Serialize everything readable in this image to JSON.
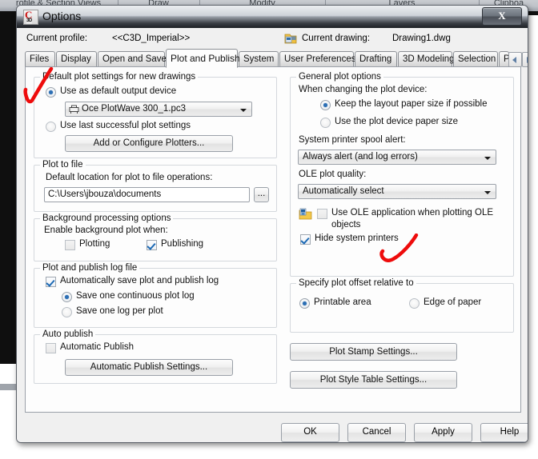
{
  "background": {
    "ribbon_tabs": [
      "rofile & Section Views",
      "Draw",
      "Modify",
      "Layers",
      "Clipboa"
    ]
  },
  "window": {
    "title": "Options",
    "icon": "civil3d-icon",
    "close_label": "X"
  },
  "profile_bar": {
    "current_profile_label": "Current profile:",
    "current_profile_value": "<<C3D_Imperial>>",
    "current_drawing_label": "Current drawing:",
    "current_drawing_value": "Drawing1.dwg",
    "drawing_icon": "drawing-file-icon"
  },
  "tabs": {
    "items": [
      {
        "label": "Files",
        "active": false
      },
      {
        "label": "Display",
        "active": false
      },
      {
        "label": "Open and Save",
        "active": false
      },
      {
        "label": "Plot and Publish",
        "active": true
      },
      {
        "label": "System",
        "active": false
      },
      {
        "label": "User Preferences",
        "active": false
      },
      {
        "label": "Drafting",
        "active": false
      },
      {
        "label": "3D Modeling",
        "active": false
      },
      {
        "label": "Selection",
        "active": false
      },
      {
        "label": "P",
        "active": false
      }
    ],
    "scroll_left": "◄",
    "scroll_right": "►"
  },
  "left_column": {
    "default_plot": {
      "title": "Default plot settings for new drawings",
      "radio_default_device": {
        "label": "Use as default output device",
        "checked": true
      },
      "device_combo": {
        "value": "Oce PlotWave 300_1.pc3",
        "icon": "plotter-icon"
      },
      "radio_last_settings": {
        "label": "Use last successful plot settings",
        "checked": false
      },
      "configure_button": "Add or Configure Plotters..."
    },
    "plot_to_file": {
      "title": "Plot to file",
      "label": "Default location for plot to file operations:",
      "path_value": "C:\\Users\\jbouza\\documents",
      "browse_button": "..."
    },
    "background_processing": {
      "title": "Background processing options",
      "label": "Enable background plot when:",
      "plotting": {
        "label": "Plotting",
        "checked": false
      },
      "publishing": {
        "label": "Publishing",
        "checked": true
      }
    },
    "log_file": {
      "title": "Plot and publish log file",
      "auto_save": {
        "label": "Automatically save plot and publish log",
        "checked": true
      },
      "continuous": {
        "label": "Save one continuous plot log",
        "checked": true
      },
      "per_plot": {
        "label": "Save one log per plot",
        "checked": false
      }
    },
    "auto_publish": {
      "title": "Auto publish",
      "automatic_publish": {
        "label": "Automatic Publish",
        "checked": false
      },
      "settings_button": "Automatic Publish Settings..."
    }
  },
  "right_column": {
    "general_plot": {
      "title": "General plot options",
      "when_changing_label": "When changing the plot device:",
      "keep_layout": {
        "label": "Keep the layout paper size if possible",
        "checked": true
      },
      "use_device_size": {
        "label": "Use the plot device paper size",
        "checked": false
      },
      "spool_alert_label": "System printer spool alert:",
      "spool_alert_value": "Always alert (and log errors)",
      "ole_quality_label": "OLE plot quality:",
      "ole_quality_value": "Automatically select",
      "ole_app": {
        "label_line1": "Use OLE application when plotting OLE",
        "label_line2": "objects",
        "checked": false,
        "icon": "ole-folder-icon"
      },
      "hide_system_printers": {
        "label": "Hide system printers",
        "checked": true
      }
    },
    "plot_offset": {
      "title": "Specify plot offset relative to",
      "printable_area": {
        "label": "Printable area",
        "checked": true
      },
      "edge_of_paper": {
        "label": "Edge of paper",
        "checked": false
      }
    },
    "plot_stamp_button": "Plot Stamp Settings...",
    "plot_style_button": "Plot Style Table Settings..."
  },
  "footer": {
    "ok": "OK",
    "cancel": "Cancel",
    "apply": "Apply",
    "help": "Help"
  },
  "annotations": {
    "color": "#ee0c0c",
    "marks": [
      "checkmark-near-default-plot-settings",
      "swoosh-near-hide-system-printers"
    ]
  }
}
